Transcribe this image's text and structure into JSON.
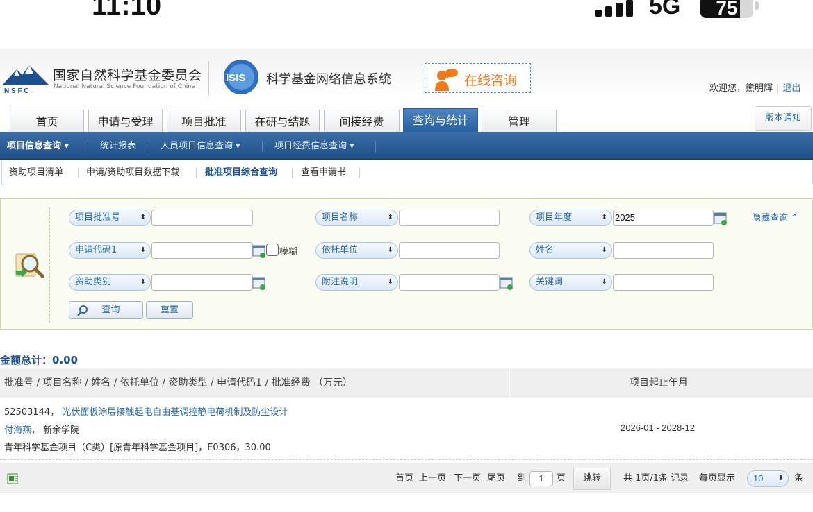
{
  "status_bar": {
    "time": "11:10",
    "network": "5G",
    "battery": "75",
    "battery_level": 0.75
  },
  "header": {
    "org_cn": "国家自然科学基金委员会",
    "org_en": "National Natural Science Foundation of China",
    "logo_abbr": "N S F C",
    "isis_logo_text": "ISIS",
    "system_name": "科学基金网络信息系统",
    "consult": "在线咨询",
    "welcome": "欢迎您，熊明辉",
    "logout": "退出",
    "notice": "版本通知"
  },
  "tabs": [
    "首页",
    "申请与受理",
    "项目批准",
    "在研与结题",
    "间接经费",
    "查询与统计",
    "管理"
  ],
  "active_tab": "查询与统计",
  "subnav": [
    "项目信息查询",
    "统计报表",
    "人员项目信息查询",
    "项目经费信息查询"
  ],
  "subsubnav": [
    "资助项目清单",
    "申请/资助项目数据下载",
    "批准项目综合查询",
    "查看申请书"
  ],
  "query": {
    "hide_label": "隐藏查询",
    "fields": [
      {
        "label": "项目批准号",
        "value": ""
      },
      {
        "label": "项目名称",
        "value": ""
      },
      {
        "label": "项目年度",
        "value": "2025"
      },
      {
        "label": "申请代码1",
        "value": ""
      },
      {
        "label": "依托单位",
        "value": ""
      },
      {
        "label": "姓名",
        "value": ""
      },
      {
        "label": "资助类别",
        "value": ""
      },
      {
        "label": "附注说明",
        "value": ""
      },
      {
        "label": "关键词",
        "value": ""
      }
    ],
    "fuzzy_label": "模糊",
    "search_button": "查询",
    "reset_button": "重置"
  },
  "total": {
    "label": "金额总计：",
    "value": "0.00"
  },
  "table": {
    "header_main": "批准号 / 项目名称 / 姓名 / 依托单位 / 资助类型 / 申请代码1 / 批准经费 （万元）",
    "header_date": "项目起止年月",
    "rows": [
      {
        "grant_no": "52503144，",
        "title": "光伏面板涂层接触起电自由基调控静电荷机制及防尘设计",
        "person": "付海燕",
        "institution": "， 新余学院",
        "detail": "青年科学基金项目（C类）[原青年科学基金项目]，E0306，30.00",
        "period": "2026-01 - 2028-12"
      }
    ]
  },
  "pager": {
    "first": "首页",
    "prev": "上一页",
    "next": "下一页",
    "last": "尾页",
    "goto": "到",
    "page_value": "1",
    "page_unit": "页",
    "jump": "跳转",
    "summary": "共 1页/1条 记录",
    "per_page_label": "每页显示",
    "per_page_value": "10",
    "per_page_unit": "条"
  }
}
